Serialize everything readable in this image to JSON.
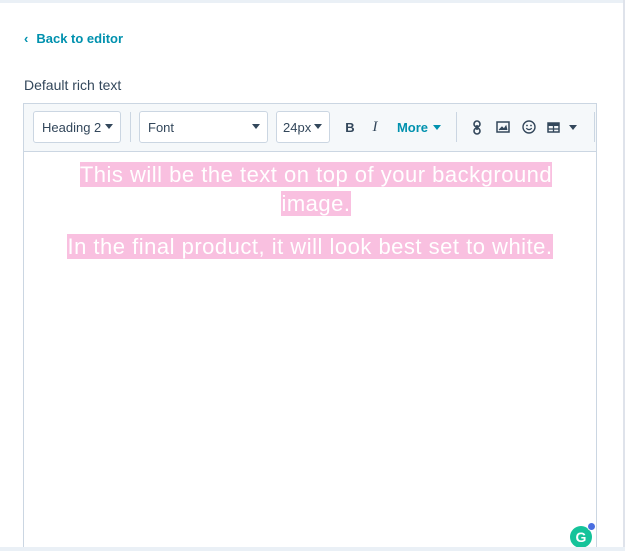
{
  "back_link": {
    "label": "Back to editor",
    "icon": "chevron-left-icon"
  },
  "field_label": "Default rich text",
  "toolbar": {
    "heading_select": "Heading 2",
    "font_select": "Font",
    "size_select": "24px",
    "bold_label": "B",
    "italic_label": "I",
    "more_label": "More",
    "icons": [
      "link-icon",
      "image-icon",
      "emoji-icon",
      "table-icon"
    ]
  },
  "content": {
    "paragraph_1_line_1": "This will be the text on top of your background",
    "paragraph_1_line_2": "image.",
    "paragraph_2": "In the final product, it will look best set to white.",
    "highlight_color": "#f9c0e0",
    "text_color": "#ffffff"
  },
  "grammarly": {
    "label": "G",
    "color": "#15c39a"
  },
  "colors": {
    "accent": "#0091ae",
    "text": "#33475b",
    "border": "#cbd6e2",
    "toolbar_bg": "#f5f8fa"
  }
}
